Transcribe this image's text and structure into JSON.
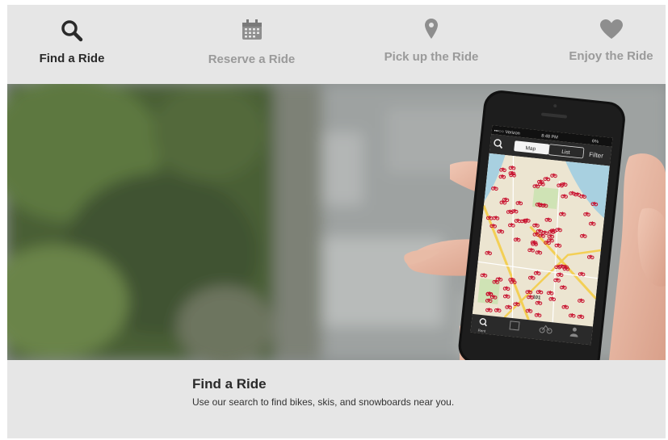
{
  "steps": [
    {
      "icon": "search-icon",
      "label": "Find a Ride",
      "active": true
    },
    {
      "icon": "calendar-icon",
      "label": "Reserve a Ride",
      "active": false
    },
    {
      "icon": "map-pin-icon",
      "label": "Pick up the Ride",
      "active": false
    },
    {
      "icon": "heart-icon",
      "label": "Enjoy the Ride",
      "active": false
    }
  ],
  "phone": {
    "carrier": "•••○○ Verizon",
    "time": "8:48 PM",
    "battery": "6%",
    "toggle_map": "Map",
    "toggle_list": "List",
    "filter": "Filter",
    "bottom_nav": [
      {
        "icon": "search-icon",
        "label": "Rent"
      },
      {
        "icon": "calendar-icon",
        "label": ""
      },
      {
        "icon": "bike-icon",
        "label": ""
      },
      {
        "icon": "person-icon",
        "label": ""
      }
    ],
    "map_label": "101"
  },
  "caption": {
    "title": "Find a Ride",
    "text": "Use our search to find bikes, skis, and snowboards near you."
  },
  "colors": {
    "active_text": "#2a2a2a",
    "inactive_text": "#9a9a9a",
    "panel_bg": "#e6e6e6",
    "bike_marker": "#c8102e"
  }
}
